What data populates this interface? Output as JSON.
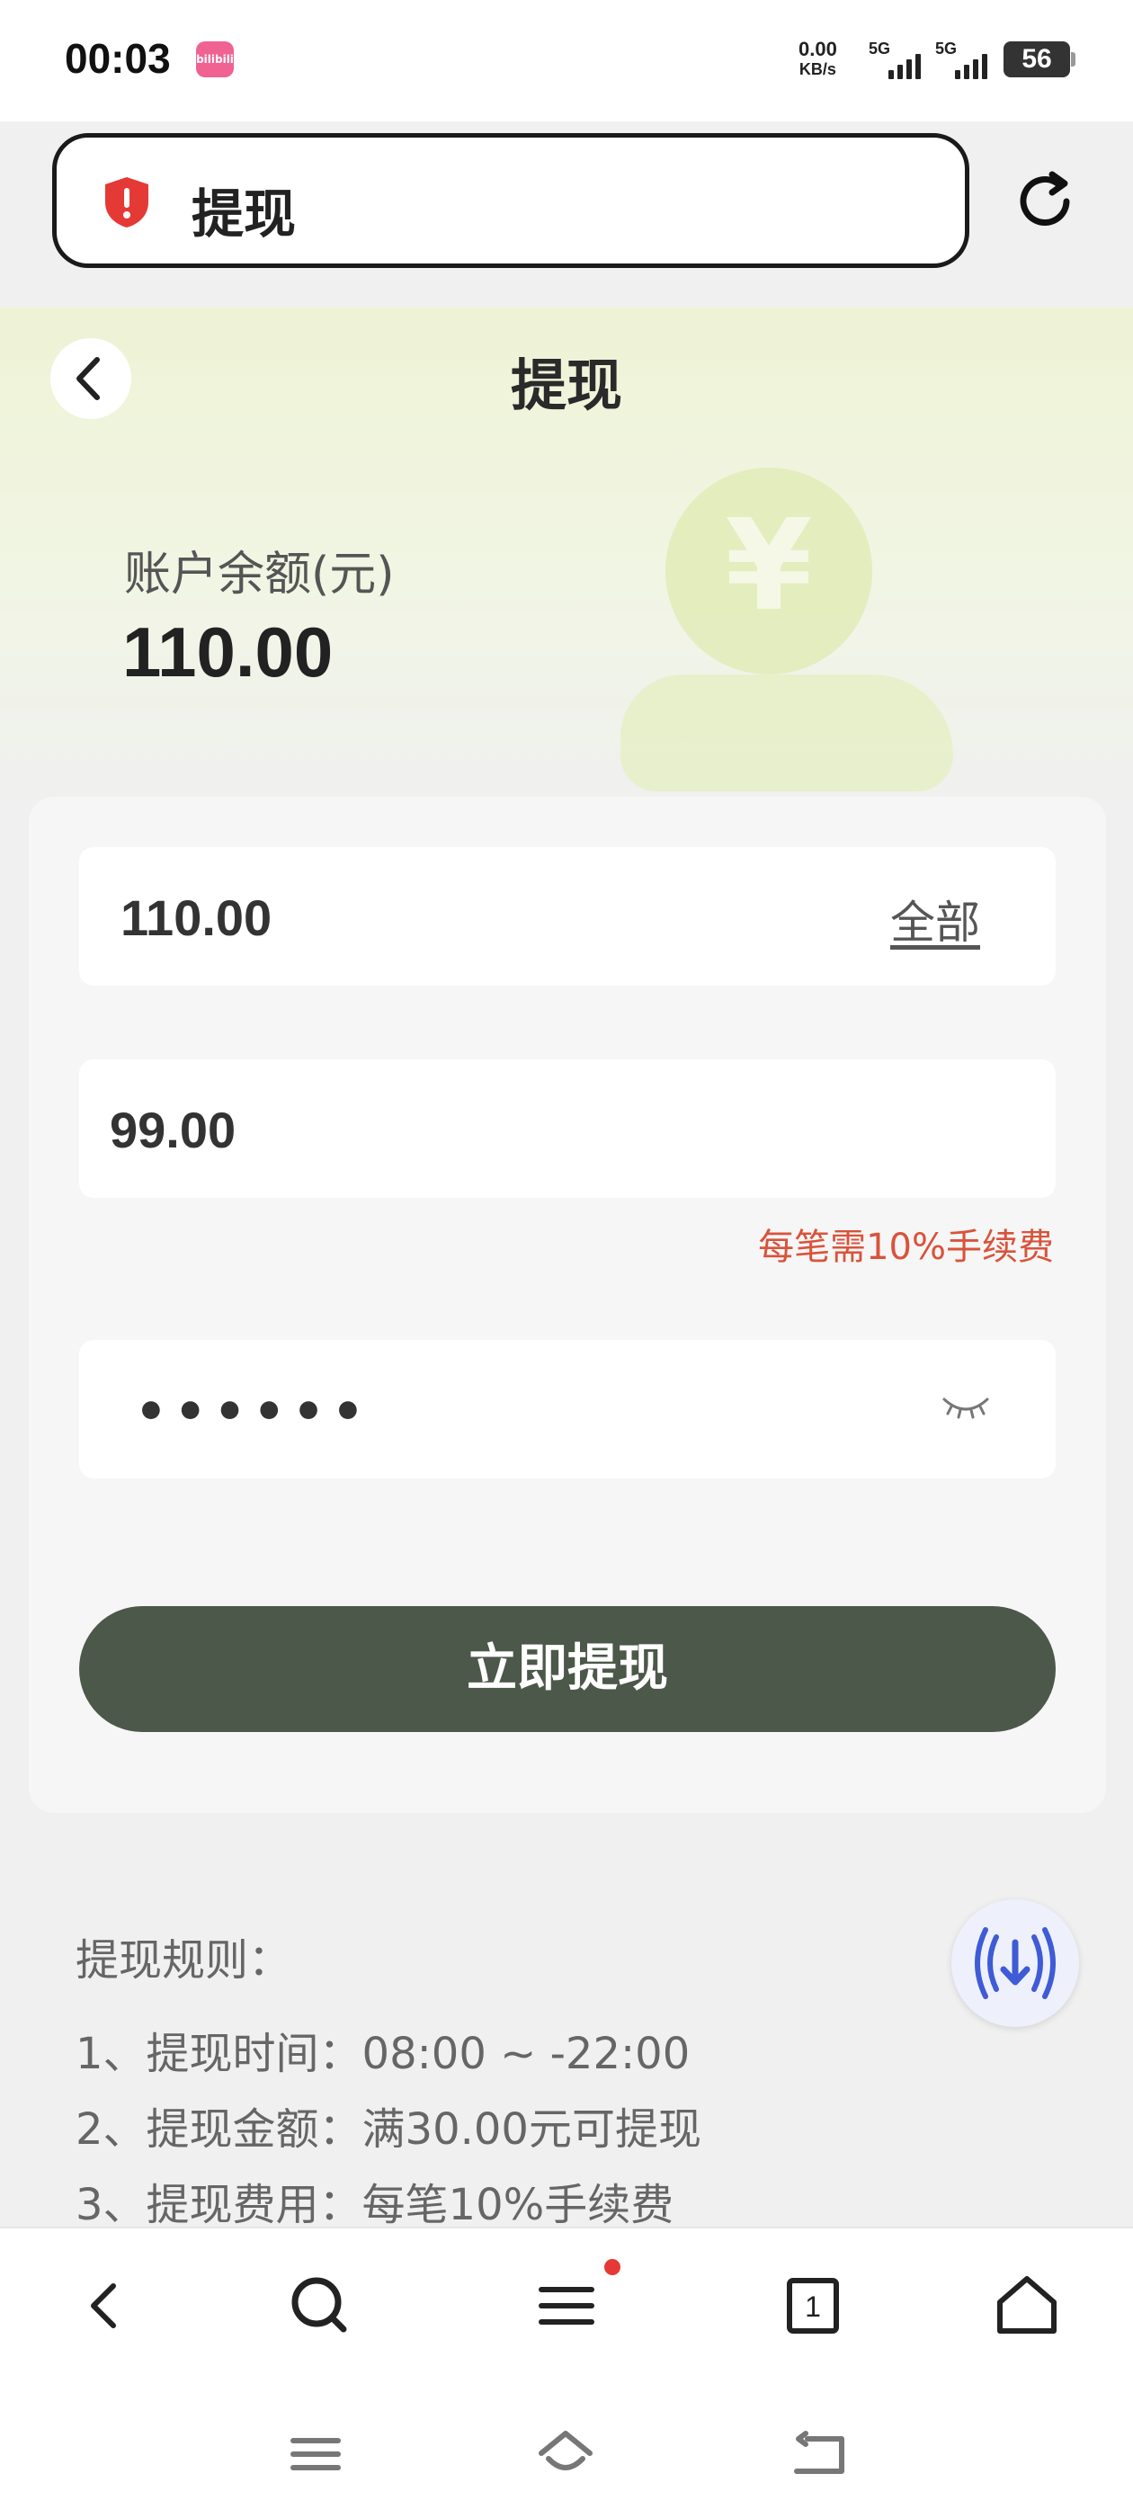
{
  "status_bar": {
    "time": "00:03",
    "app_badge": "bilibili",
    "net_speed_value": "0.00",
    "net_speed_unit": "KB/s",
    "signal1": "5G",
    "signal2": "5G",
    "battery": "56"
  },
  "address_bar": {
    "title": "提现"
  },
  "page": {
    "title": "提现",
    "balance_label": "账户余额(元)",
    "balance_value": "110.00",
    "coin_symbol": "¥"
  },
  "form": {
    "amount_value": "110.00",
    "all_label": "全部",
    "actual_value": "99.00",
    "fee_note": "每笔需10%手续费",
    "password_mask": "••••••",
    "submit_label": "立即提现"
  },
  "rules": {
    "title": "提现规则：",
    "items": [
      "1、提现时间：08:00 ~ -22:00",
      "2、提现金额：满30.00元可提现",
      "3、提现费用：每笔10%手续费"
    ]
  },
  "browser_nav": {
    "tab_count": "1"
  },
  "colors": {
    "accent_button": "#4c5849",
    "fee_note": "#d9533b",
    "shield": "#e53935",
    "float_button_icon": "#3f5bd6"
  }
}
